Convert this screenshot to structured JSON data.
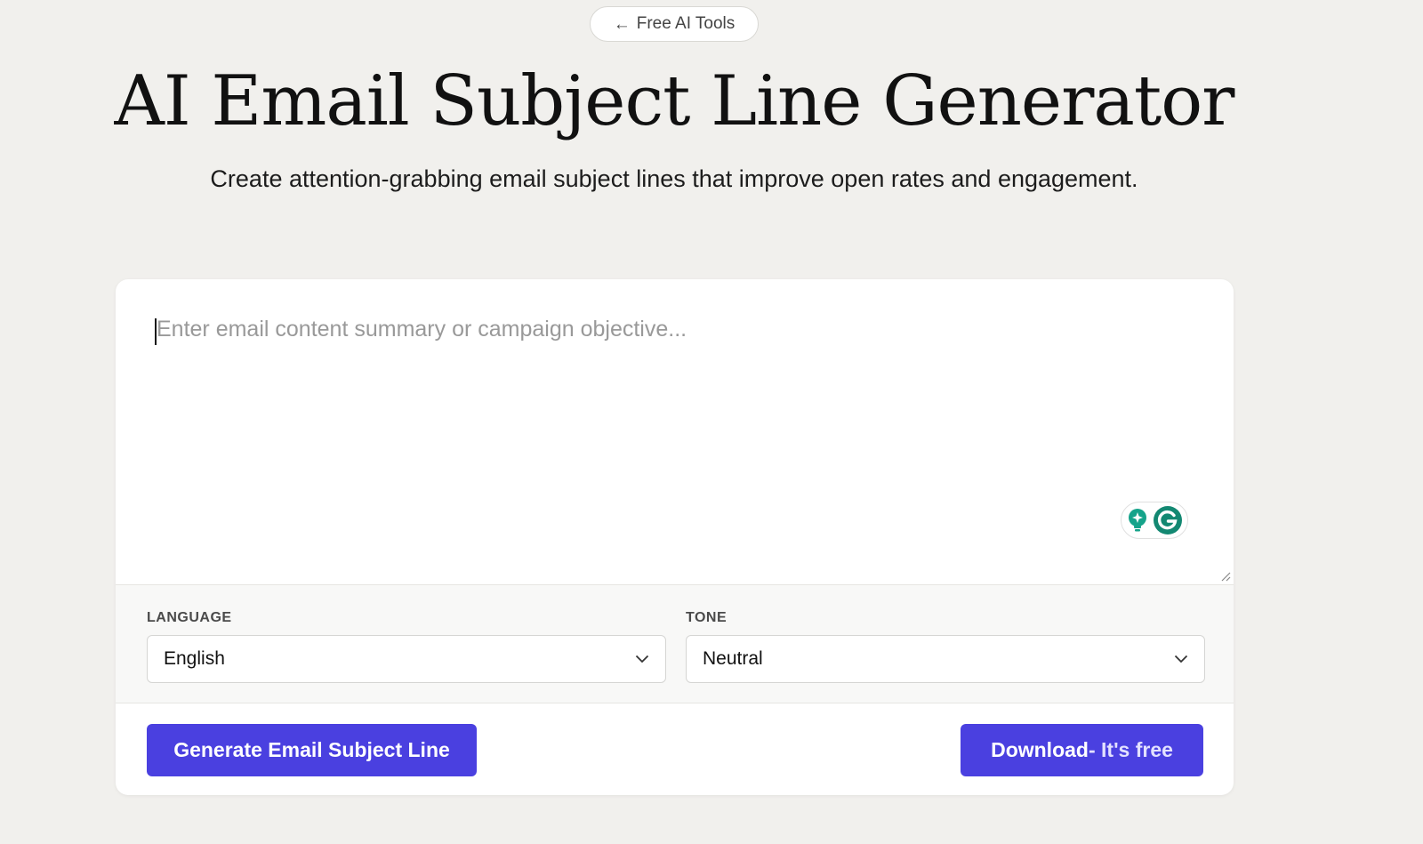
{
  "back_link": {
    "arrow": "←",
    "label": "Free AI Tools"
  },
  "hero": {
    "title": "AI Email Subject Line Generator",
    "subtitle": "Create attention-grabbing email subject lines that improve open rates and engagement."
  },
  "editor": {
    "placeholder": "Enter email content summary or campaign objective...",
    "value": "",
    "extension_icons": [
      "lightbulb-icon",
      "grammarly-icon"
    ]
  },
  "options": {
    "language": {
      "label": "LANGUAGE",
      "selected": "English"
    },
    "tone": {
      "label": "TONE",
      "selected": "Neutral"
    }
  },
  "actions": {
    "generate_label": "Generate Email Subject Line",
    "download_label": "Download",
    "download_suffix": "- It's free"
  },
  "colors": {
    "background": "#f1f0ed",
    "accent": "#4a40e0",
    "grammarly": "#15a38a"
  }
}
